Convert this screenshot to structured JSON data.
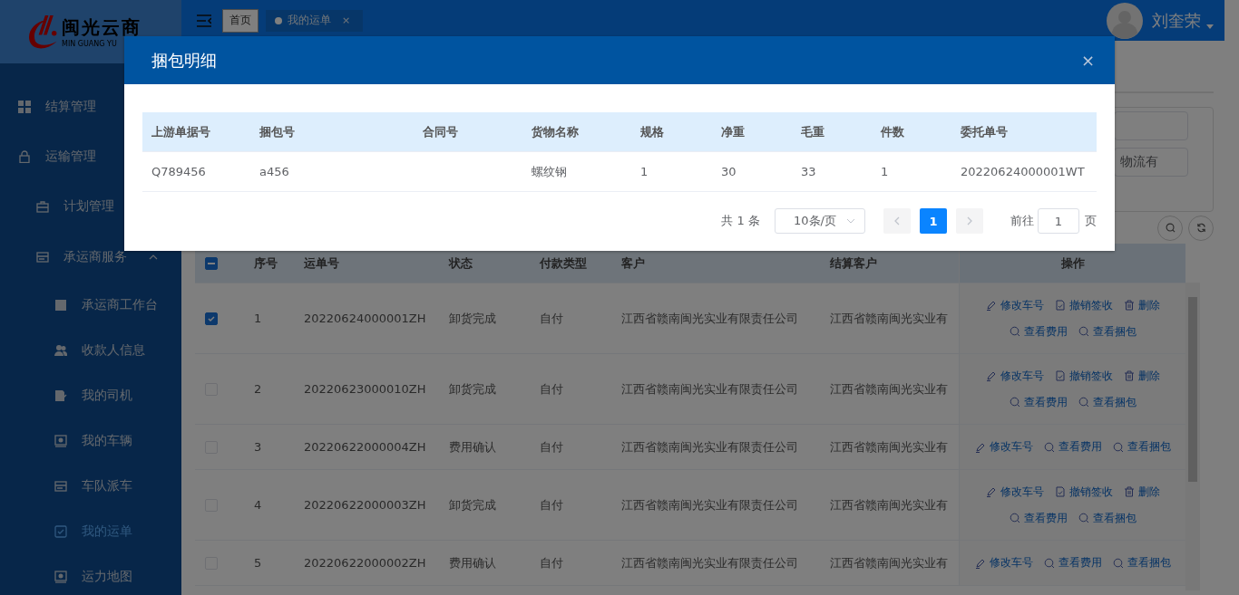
{
  "logo": {
    "title": "闽光云商",
    "subtitle": "MIN GUANG YU"
  },
  "sidebar": {
    "items": [
      {
        "label": "结算管理"
      },
      {
        "label": "运输管理",
        "children": [
          {
            "label": "计划管理"
          },
          {
            "label": "承运商服务",
            "expanded": true,
            "children": [
              {
                "label": "承运商工作台",
                "selected": false
              },
              {
                "label": "收款人信息",
                "selected": false
              },
              {
                "label": "我的司机",
                "selected": false
              },
              {
                "label": "我的车辆",
                "selected": false
              },
              {
                "label": "车队派车",
                "selected": false
              },
              {
                "label": "我的运单",
                "selected": true
              },
              {
                "label": "运力地图",
                "selected": false
              }
            ]
          }
        ]
      }
    ]
  },
  "header": {
    "tabs": [
      {
        "label": "首页",
        "selected": false
      },
      {
        "label": "我的运单",
        "selected": true,
        "close": "×"
      }
    ],
    "user": {
      "name": "刘奎荣"
    }
  },
  "filters": [
    {
      "value": "物流有"
    }
  ],
  "table": {
    "header_indeterminate": true,
    "columns": [
      "序号",
      "运单号",
      "状态",
      "付款类型",
      "客户",
      "结算客户",
      "操作"
    ],
    "rows": [
      {
        "selected": true,
        "cells": [
          "1",
          "20220624000001ZH",
          "卸货完成",
          "自付",
          "江西省赣南闽光实业有限责任公司",
          "江西省赣南闽光实业有"
        ],
        "actions": [
          {
            "kind": "edit",
            "label": "修改车号"
          },
          {
            "kind": "revoke",
            "label": "撤销签收"
          },
          {
            "kind": "delete",
            "label": "删除"
          },
          {
            "kind": "view",
            "label": "查看费用"
          },
          {
            "kind": "view",
            "label": "查看捆包"
          }
        ]
      },
      {
        "selected": false,
        "cells": [
          "2",
          "20220623000010ZH",
          "卸货完成",
          "自付",
          "江西省赣南闽光实业有限责任公司",
          "江西省赣南闽光实业有"
        ],
        "actions": [
          {
            "kind": "edit",
            "label": "修改车号"
          },
          {
            "kind": "revoke",
            "label": "撤销签收"
          },
          {
            "kind": "delete",
            "label": "删除"
          },
          {
            "kind": "view",
            "label": "查看费用"
          },
          {
            "kind": "view",
            "label": "查看捆包"
          }
        ]
      },
      {
        "selected": false,
        "cells": [
          "3",
          "20220622000004ZH",
          "费用确认",
          "自付",
          "江西省赣南闽光实业有限责任公司",
          "江西省赣南闽光实业有"
        ],
        "actions": [
          {
            "kind": "edit",
            "label": "修改车号"
          },
          {
            "kind": "view",
            "label": "查看费用"
          },
          {
            "kind": "view",
            "label": "查看捆包"
          }
        ]
      },
      {
        "selected": false,
        "cells": [
          "4",
          "20220622000003ZH",
          "卸货完成",
          "自付",
          "江西省赣南闽光实业有限责任公司",
          "江西省赣南闽光实业有"
        ],
        "actions": [
          {
            "kind": "edit",
            "label": "修改车号"
          },
          {
            "kind": "revoke",
            "label": "撤销签收"
          },
          {
            "kind": "delete",
            "label": "删除"
          },
          {
            "kind": "view",
            "label": "查看费用"
          },
          {
            "kind": "view",
            "label": "查看捆包"
          }
        ]
      },
      {
        "selected": false,
        "cells": [
          "5",
          "20220622000002ZH",
          "费用确认",
          "自付",
          "江西省赣南闽光实业有限责任公司",
          "江西省赣南闽光实业有"
        ],
        "actions": [
          {
            "kind": "edit",
            "label": "修改车号"
          },
          {
            "kind": "view",
            "label": "查看费用"
          },
          {
            "kind": "view",
            "label": "查看捆包"
          }
        ]
      }
    ]
  },
  "dialog": {
    "title": "捆包明细",
    "close": "×",
    "table": {
      "columns": [
        "上游单据号",
        "捆包号",
        "合同号",
        "货物名称",
        "规格",
        "净重",
        "毛重",
        "件数",
        "委托单号"
      ],
      "rows": [
        {
          "cells": [
            "Q789456",
            "a456",
            null,
            "螺纹钢",
            "1",
            "30",
            "33",
            "1",
            "20220624000001WT"
          ]
        }
      ]
    },
    "pagination": {
      "total": "共 1 条",
      "page_size": "10条/页",
      "pages": [
        {
          "label": "1",
          "selected": true
        }
      ],
      "goto_label": "前往",
      "goto_value": "1",
      "goto_suffix": "页"
    }
  }
}
